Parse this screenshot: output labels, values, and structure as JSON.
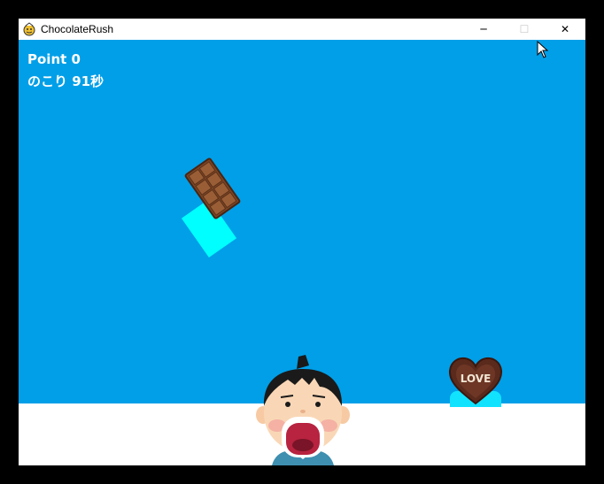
{
  "window": {
    "title": "ChocolateRush",
    "minimize_glyph": "─",
    "maximize_glyph": "☐",
    "close_glyph": "✕"
  },
  "hud": {
    "score_text": "Point 0",
    "timer_text": "のこり 91秒"
  },
  "sprites": {
    "falling_chocolate": "chocolate-bar-icon",
    "falling_heart": "heart-chocolate-icon",
    "heart_label": "LOVE",
    "player": "boy-open-mouth-icon"
  },
  "colors": {
    "sky": "#009fe8",
    "ground": "#ffffff",
    "hitbox": "#00ffff"
  }
}
